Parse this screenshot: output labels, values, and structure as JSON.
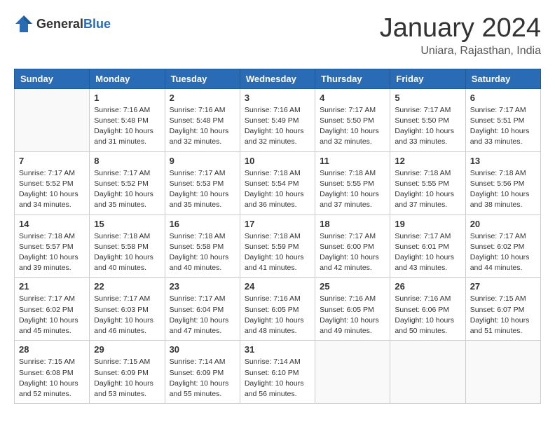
{
  "header": {
    "logo_general": "General",
    "logo_blue": "Blue",
    "title": "January 2024",
    "location": "Uniara, Rajasthan, India"
  },
  "days_of_week": [
    "Sunday",
    "Monday",
    "Tuesday",
    "Wednesday",
    "Thursday",
    "Friday",
    "Saturday"
  ],
  "weeks": [
    [
      {
        "day": "",
        "info": ""
      },
      {
        "day": "1",
        "info": "Sunrise: 7:16 AM\nSunset: 5:48 PM\nDaylight: 10 hours\nand 31 minutes."
      },
      {
        "day": "2",
        "info": "Sunrise: 7:16 AM\nSunset: 5:48 PM\nDaylight: 10 hours\nand 32 minutes."
      },
      {
        "day": "3",
        "info": "Sunrise: 7:16 AM\nSunset: 5:49 PM\nDaylight: 10 hours\nand 32 minutes."
      },
      {
        "day": "4",
        "info": "Sunrise: 7:17 AM\nSunset: 5:50 PM\nDaylight: 10 hours\nand 32 minutes."
      },
      {
        "day": "5",
        "info": "Sunrise: 7:17 AM\nSunset: 5:50 PM\nDaylight: 10 hours\nand 33 minutes."
      },
      {
        "day": "6",
        "info": "Sunrise: 7:17 AM\nSunset: 5:51 PM\nDaylight: 10 hours\nand 33 minutes."
      }
    ],
    [
      {
        "day": "7",
        "info": "Sunrise: 7:17 AM\nSunset: 5:52 PM\nDaylight: 10 hours\nand 34 minutes."
      },
      {
        "day": "8",
        "info": "Sunrise: 7:17 AM\nSunset: 5:52 PM\nDaylight: 10 hours\nand 35 minutes."
      },
      {
        "day": "9",
        "info": "Sunrise: 7:17 AM\nSunset: 5:53 PM\nDaylight: 10 hours\nand 35 minutes."
      },
      {
        "day": "10",
        "info": "Sunrise: 7:18 AM\nSunset: 5:54 PM\nDaylight: 10 hours\nand 36 minutes."
      },
      {
        "day": "11",
        "info": "Sunrise: 7:18 AM\nSunset: 5:55 PM\nDaylight: 10 hours\nand 37 minutes."
      },
      {
        "day": "12",
        "info": "Sunrise: 7:18 AM\nSunset: 5:55 PM\nDaylight: 10 hours\nand 37 minutes."
      },
      {
        "day": "13",
        "info": "Sunrise: 7:18 AM\nSunset: 5:56 PM\nDaylight: 10 hours\nand 38 minutes."
      }
    ],
    [
      {
        "day": "14",
        "info": "Sunrise: 7:18 AM\nSunset: 5:57 PM\nDaylight: 10 hours\nand 39 minutes."
      },
      {
        "day": "15",
        "info": "Sunrise: 7:18 AM\nSunset: 5:58 PM\nDaylight: 10 hours\nand 40 minutes."
      },
      {
        "day": "16",
        "info": "Sunrise: 7:18 AM\nSunset: 5:58 PM\nDaylight: 10 hours\nand 40 minutes."
      },
      {
        "day": "17",
        "info": "Sunrise: 7:18 AM\nSunset: 5:59 PM\nDaylight: 10 hours\nand 41 minutes."
      },
      {
        "day": "18",
        "info": "Sunrise: 7:17 AM\nSunset: 6:00 PM\nDaylight: 10 hours\nand 42 minutes."
      },
      {
        "day": "19",
        "info": "Sunrise: 7:17 AM\nSunset: 6:01 PM\nDaylight: 10 hours\nand 43 minutes."
      },
      {
        "day": "20",
        "info": "Sunrise: 7:17 AM\nSunset: 6:02 PM\nDaylight: 10 hours\nand 44 minutes."
      }
    ],
    [
      {
        "day": "21",
        "info": "Sunrise: 7:17 AM\nSunset: 6:02 PM\nDaylight: 10 hours\nand 45 minutes."
      },
      {
        "day": "22",
        "info": "Sunrise: 7:17 AM\nSunset: 6:03 PM\nDaylight: 10 hours\nand 46 minutes."
      },
      {
        "day": "23",
        "info": "Sunrise: 7:17 AM\nSunset: 6:04 PM\nDaylight: 10 hours\nand 47 minutes."
      },
      {
        "day": "24",
        "info": "Sunrise: 7:16 AM\nSunset: 6:05 PM\nDaylight: 10 hours\nand 48 minutes."
      },
      {
        "day": "25",
        "info": "Sunrise: 7:16 AM\nSunset: 6:05 PM\nDaylight: 10 hours\nand 49 minutes."
      },
      {
        "day": "26",
        "info": "Sunrise: 7:16 AM\nSunset: 6:06 PM\nDaylight: 10 hours\nand 50 minutes."
      },
      {
        "day": "27",
        "info": "Sunrise: 7:15 AM\nSunset: 6:07 PM\nDaylight: 10 hours\nand 51 minutes."
      }
    ],
    [
      {
        "day": "28",
        "info": "Sunrise: 7:15 AM\nSunset: 6:08 PM\nDaylight: 10 hours\nand 52 minutes."
      },
      {
        "day": "29",
        "info": "Sunrise: 7:15 AM\nSunset: 6:09 PM\nDaylight: 10 hours\nand 53 minutes."
      },
      {
        "day": "30",
        "info": "Sunrise: 7:14 AM\nSunset: 6:09 PM\nDaylight: 10 hours\nand 55 minutes."
      },
      {
        "day": "31",
        "info": "Sunrise: 7:14 AM\nSunset: 6:10 PM\nDaylight: 10 hours\nand 56 minutes."
      },
      {
        "day": "",
        "info": ""
      },
      {
        "day": "",
        "info": ""
      },
      {
        "day": "",
        "info": ""
      }
    ]
  ]
}
